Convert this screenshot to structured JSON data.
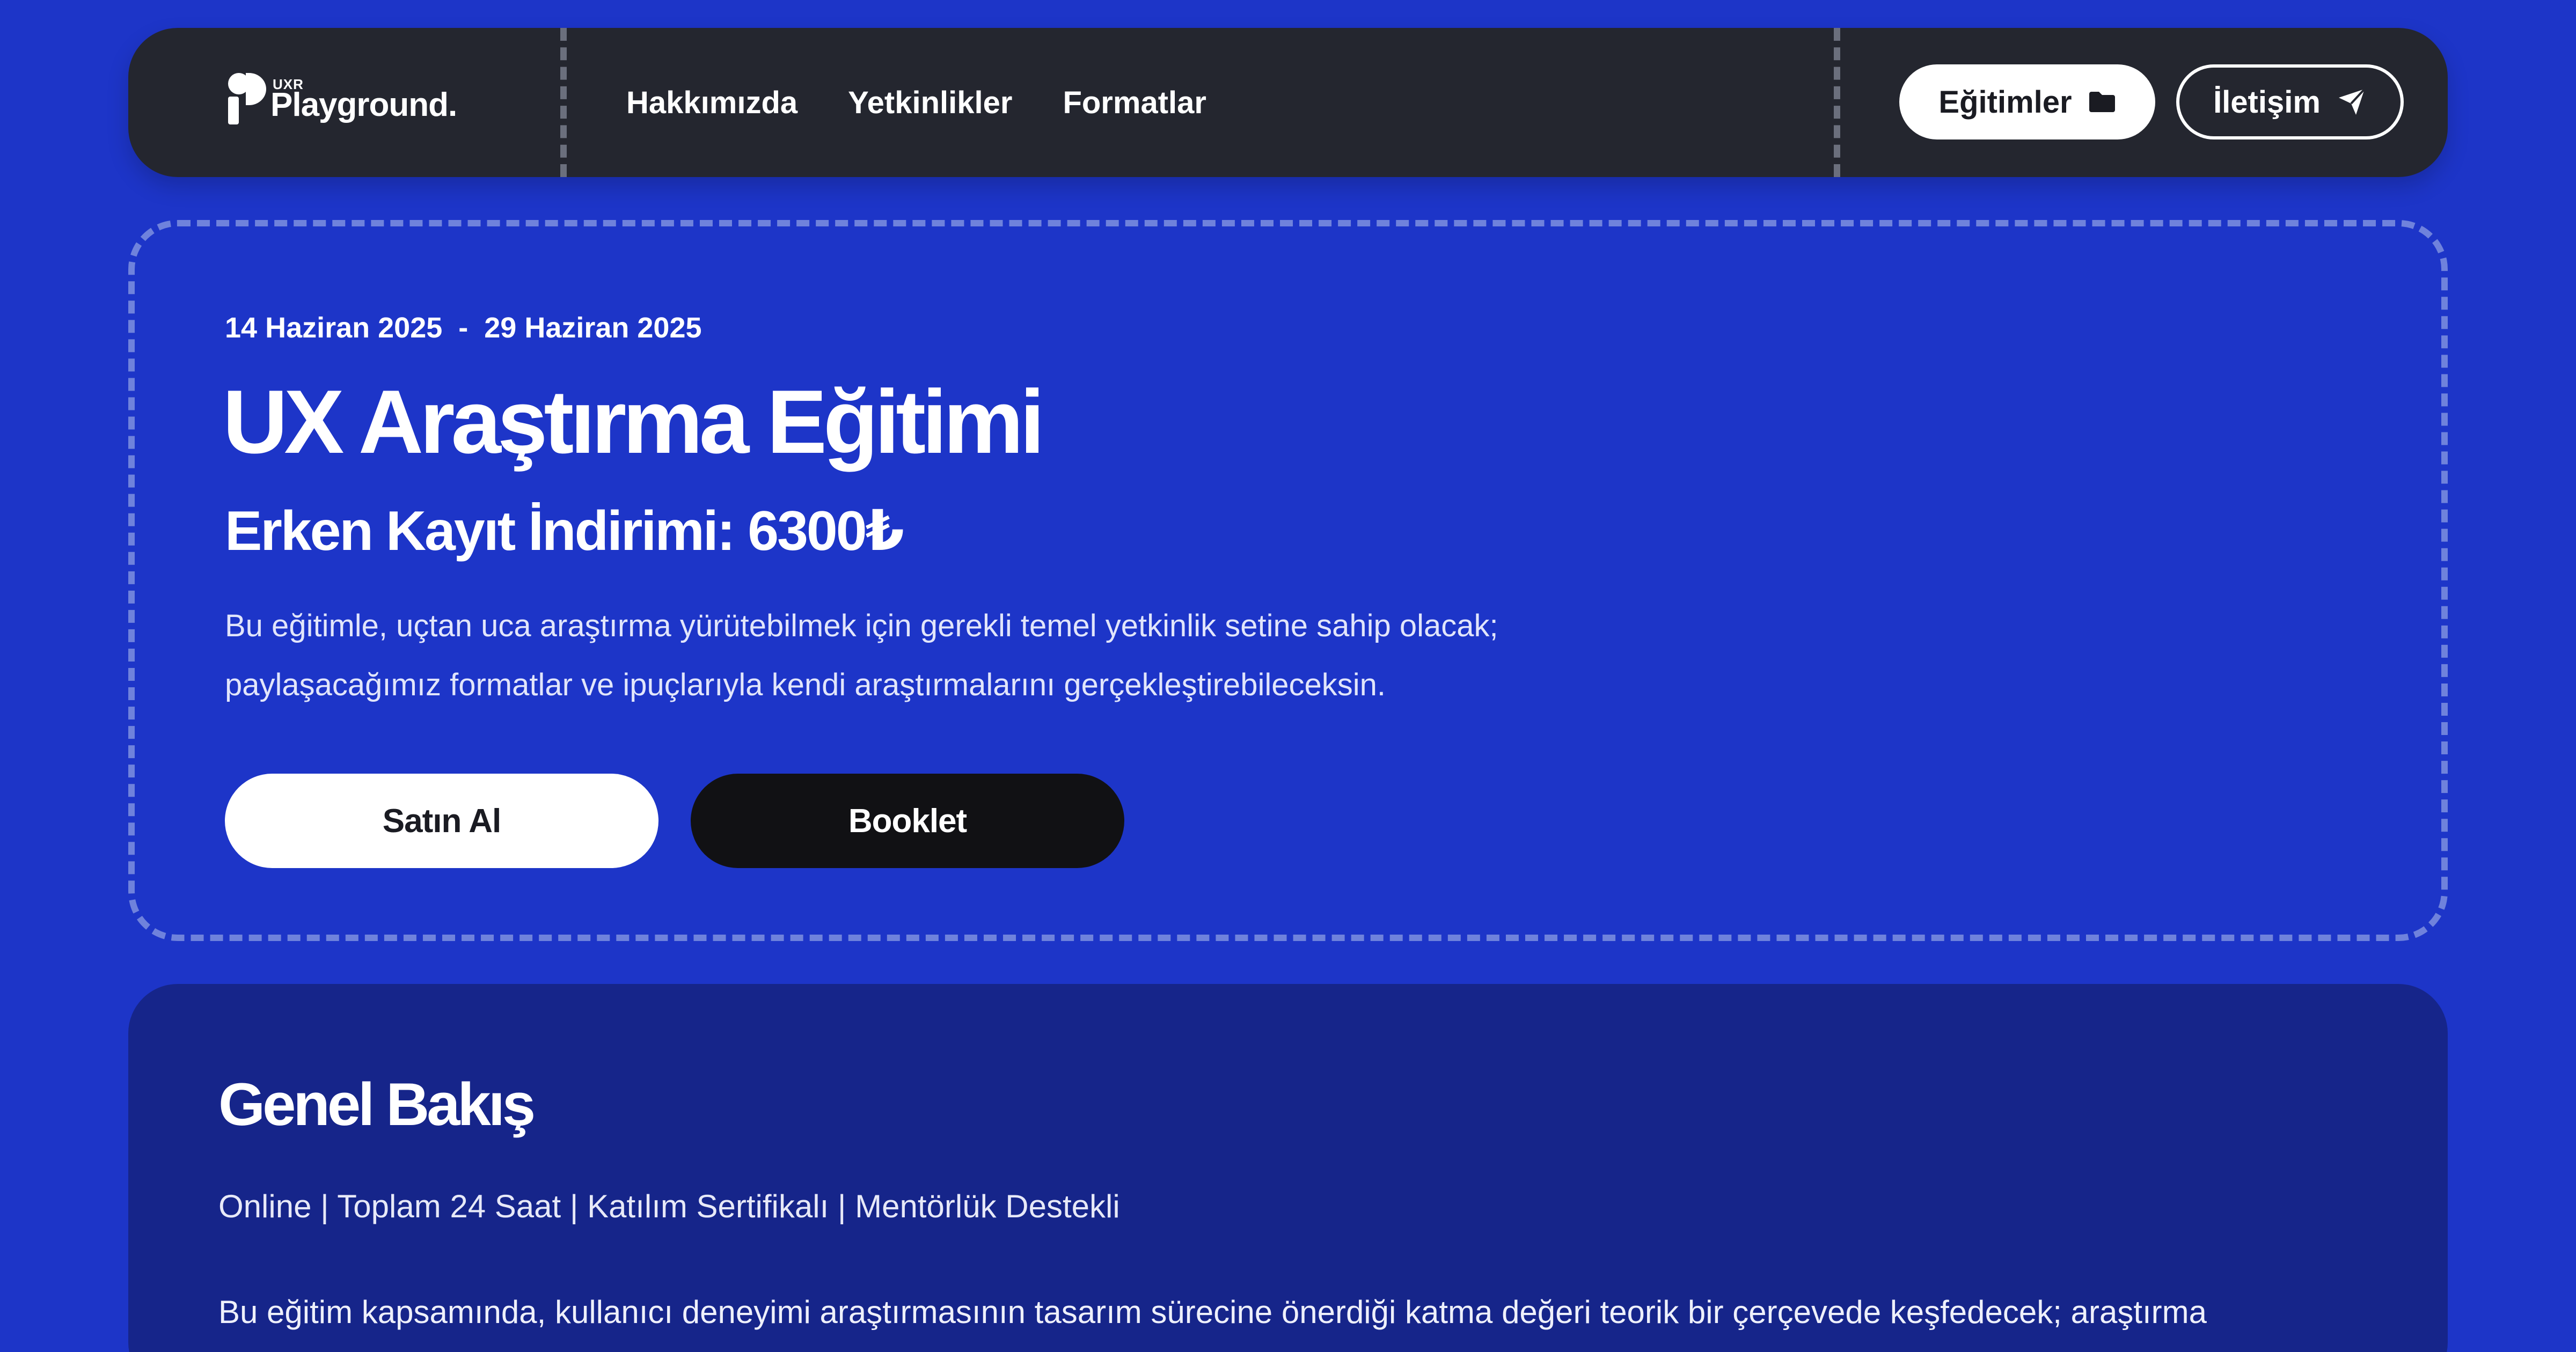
{
  "nav": {
    "logo": {
      "small": "UXR",
      "name": "Playground."
    },
    "links": [
      "Hakkımızda",
      "Yetkinlikler",
      "Formatlar"
    ],
    "courses_button": "Eğitimler",
    "contact_button": "İletişim"
  },
  "hero": {
    "date_start": "14 Haziran 2025",
    "date_separator": "-",
    "date_end": "29 Haziran 2025",
    "title": "UX Araştırma Eğitimi",
    "price": "Erken Kayıt İndirimi: 6300₺",
    "description_line1": "Bu eğitimle, uçtan uca araştırma yürütebilmek için gerekli temel yetkinlik setine sahip olacak;",
    "description_line2": "paylaşacağımız formatlar ve ipuçlarıyla kendi araştırmalarını gerçekleştirebileceksin.",
    "buy_button": "Satın Al",
    "booklet_button": "Booklet"
  },
  "overview": {
    "title": "Genel Bakış",
    "meta": "Online | Toplam 24 Saat | Katılım Sertifikalı | Mentörlük Destekli",
    "body": "Bu eğitim kapsamında, kullanıcı deneyimi araştırmasının tasarım sürecine önerdiği katma değeri teorik bir çerçevede keşfedecek; araştırma"
  },
  "colors": {
    "page_bg": "#1d35c8",
    "navbar_bg": "#24262f",
    "overview_bg": "#16258a",
    "button_dark": "#111114"
  },
  "icons": {
    "courses_button_icon": "folder-icon",
    "contact_button_icon": "send-icon"
  }
}
